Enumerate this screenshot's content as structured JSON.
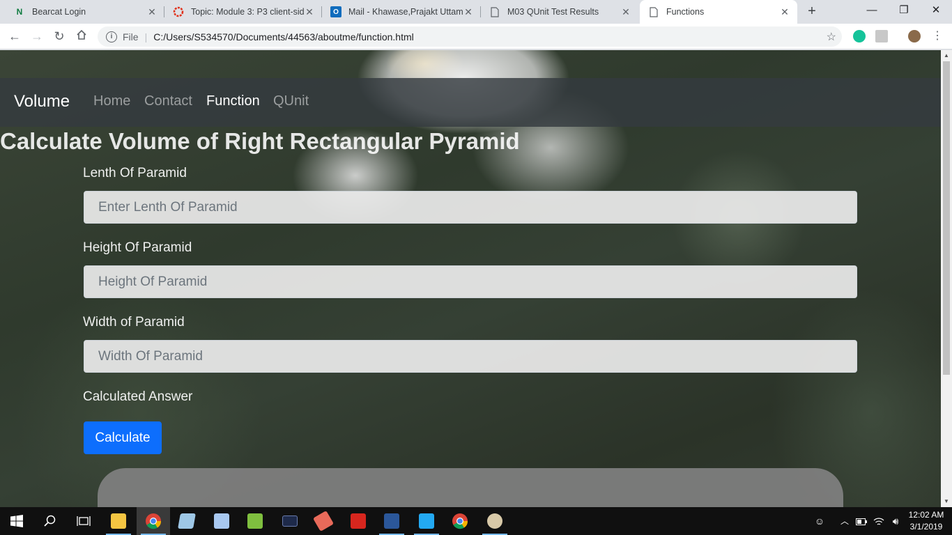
{
  "browser": {
    "tabs": [
      {
        "title": "Bearcat Login",
        "icon": "onenote-icon"
      },
      {
        "title": "Topic: Module 3: P3 client-side",
        "icon": "canvas-icon"
      },
      {
        "title": "Mail - Khawase,Prajakt Uttamrao",
        "icon": "outlook-icon"
      },
      {
        "title": "M03 QUnit Test Results",
        "icon": "document-icon"
      },
      {
        "title": "Functions",
        "icon": "document-icon"
      }
    ],
    "active_tab": 4,
    "new_tab": "+",
    "address": {
      "scheme": "File",
      "url": "C:/Users/S534570/Documents/44563/aboutme/function.html"
    }
  },
  "page": {
    "nav": {
      "brand": "Volume",
      "links": [
        "Home",
        "Contact",
        "Function",
        "QUnit"
      ],
      "active_link": "Function"
    },
    "heading": "Calculate Volume of Right Rectangular Pyramid",
    "fields": [
      {
        "label": "Lenth Of Paramid",
        "placeholder": "Enter Lenth Of Paramid"
      },
      {
        "label": "Height Of Paramid",
        "placeholder": "Height Of Paramid"
      },
      {
        "label": "Width of Paramid",
        "placeholder": "Width Of Paramid"
      }
    ],
    "answer_label": "Calculated Answer",
    "button_label": "Calculate"
  },
  "taskbar": {
    "apps": [
      "start",
      "search",
      "task-view",
      "file-explorer",
      "chrome",
      "notepad",
      "box-app",
      "editor",
      "terminal",
      "paint-app",
      "acrobat",
      "word",
      "vscode",
      "chrome-2",
      "paint-palette"
    ],
    "clock": {
      "time": "12:02 AM",
      "date": "3/1/2019"
    }
  },
  "colors": {
    "accent": "#0d6efd",
    "navbar": "#343a40",
    "taskbar": "#101010"
  }
}
